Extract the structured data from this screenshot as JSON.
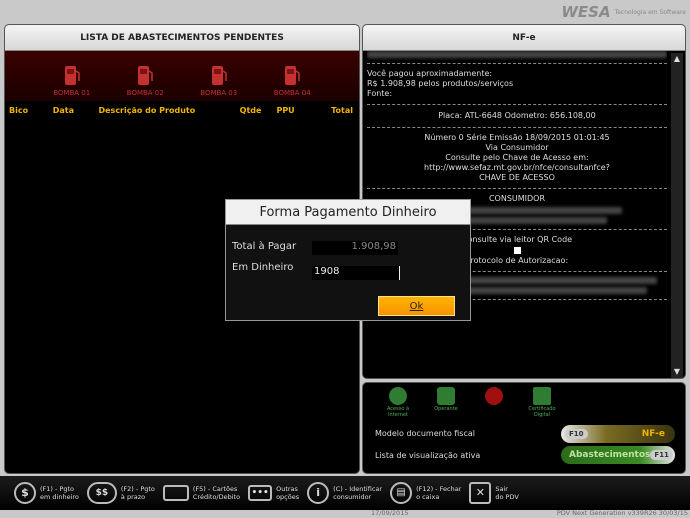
{
  "brand": {
    "logo": "WESA",
    "tagline": "Tecnologia em Software"
  },
  "left_panel": {
    "title": "LISTA DE ABASTECIMENTOS PENDENTES",
    "pumps": [
      "BOMBA 01",
      "BOMBA 02",
      "BOMBA 03",
      "BOMBA 04"
    ],
    "columns": [
      "Bico",
      "Data",
      "Descrição do Produto",
      "Qtde",
      "PPU",
      "Total"
    ]
  },
  "right_panel": {
    "title": "NF-e",
    "receipt": {
      "paid_line1": "Você pagou aproximadamente:",
      "paid_line2": "R$ 1.908,98 pelos produtos/serviços",
      "source": "Fonte:",
      "plate": "Placa: ATL-6648 Odometro: 656.108,00",
      "number": "Número 0 Série Emissão 18/09/2015 01:01:45",
      "via": "Via Consumidor",
      "consult": "Consulte pelo Chave de Acesso em:",
      "url": "http://www.sefaz.mt.gov.br/nfce/consultanfce?",
      "key": "CHAVE DE ACESSO",
      "consumer": "CONSUMIDOR",
      "qr": "Consulte via leitor QR Code",
      "protocol": "Protocolo de Autorizacao:"
    }
  },
  "options": {
    "icons": [
      "Acesso à Internet",
      "Operante",
      "",
      "Certificado Digital"
    ],
    "model_label": "Modelo documento fiscal",
    "model_key": "F10",
    "model_value": "NF-e",
    "view_label": "Lista de visualização ativa",
    "view_value": "Abastecimentos",
    "view_key": "F11"
  },
  "modal": {
    "title": "Forma Pagamento Dinheiro",
    "total_label": "Total à Pagar",
    "total_value": "1.908,98",
    "cash_label": "Em Dinheiro",
    "cash_value": "1908",
    "ok": "Ok"
  },
  "footer": {
    "buttons": [
      {
        "line1": "(F1) - Pgto",
        "line2": "em dinheiro",
        "icon": "dollar-icon"
      },
      {
        "line1": "(F2) - Pgto",
        "line2": "à prazo",
        "icon": "credit-icon"
      },
      {
        "line1": "(F5) - Cartões",
        "line2": "Crédito/Debito",
        "icon": "card-icon"
      },
      {
        "line1": "Outras",
        "line2": "opções",
        "icon": "more-icon"
      },
      {
        "line1": "(C) - Identificar",
        "line2": "consumidor",
        "icon": "info-icon"
      },
      {
        "line1": "(F12) - Fechar",
        "line2": "o caixa",
        "icon": "register-icon"
      },
      {
        "line1": "Sair",
        "line2": "do PDV",
        "icon": "exit-icon"
      }
    ]
  },
  "status": {
    "date": "17/09/2015",
    "version": "PDV Next Generation v339R26 30/03/15"
  },
  "colors": {
    "accent": "#f0b400",
    "pump_red": "#c53030",
    "green": "#4caf50",
    "ok_orange": "#f59300"
  }
}
